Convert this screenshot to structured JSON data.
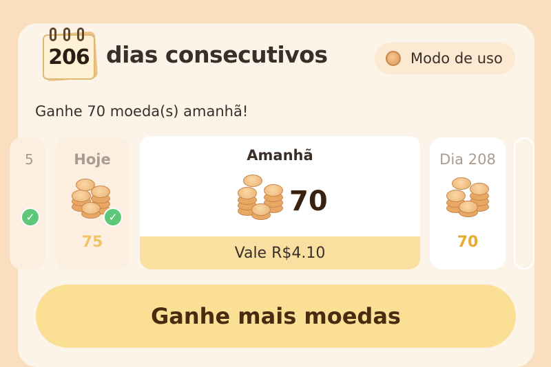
{
  "header": {
    "streak_count": "206",
    "title": "dias consecutivos",
    "usage_button": "Modo de uso"
  },
  "subtitle": "Ganhe 70 moeda(s) amanhã!",
  "days": {
    "prev": {
      "label": "5"
    },
    "today": {
      "label": "Hoje",
      "amount": "75",
      "claimed": true
    },
    "tomorrow": {
      "label": "Amanhã",
      "amount": "70",
      "value": "Vale R$4.10"
    },
    "next": {
      "label": "Dia 208",
      "amount": "70"
    }
  },
  "cta": {
    "label": "Ganhe mais moedas"
  },
  "colors": {
    "background": "#f9dfc0",
    "card": "#fdf4e9",
    "cta": "#fbdf95",
    "accent_gold": "#e8aa2f",
    "check_green": "#5fc77a"
  }
}
